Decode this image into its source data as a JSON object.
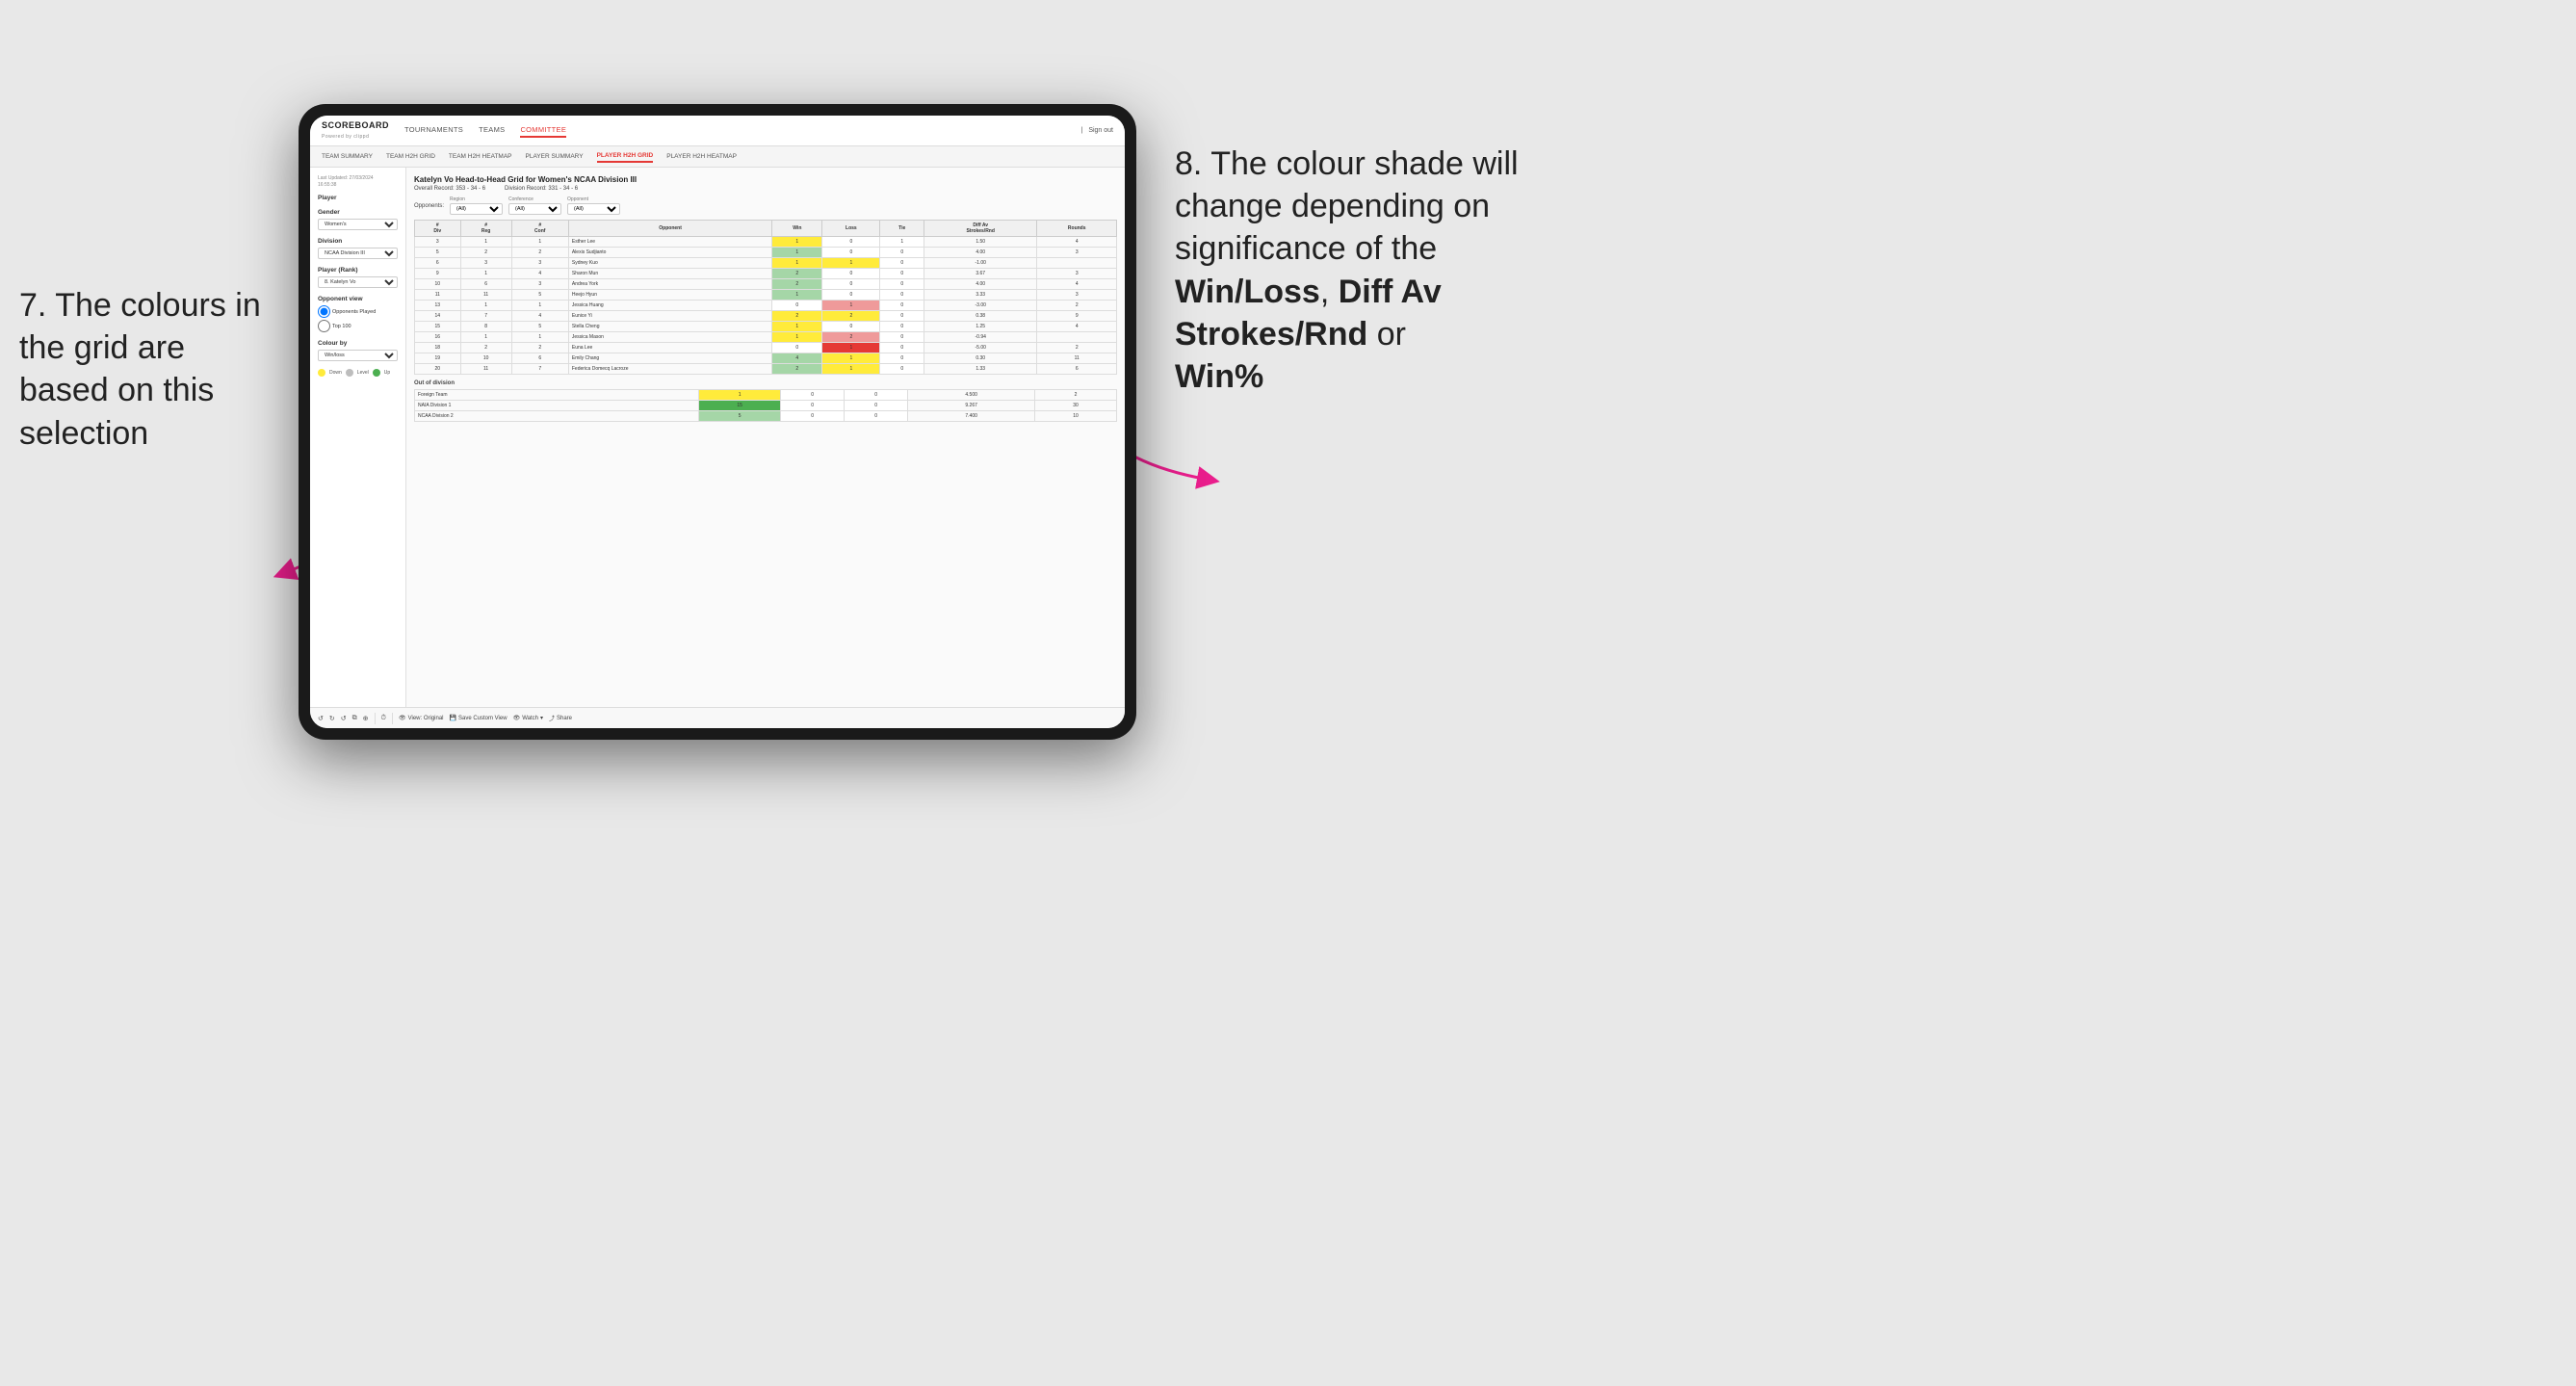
{
  "annotations": {
    "left_title": "7. The colours in the grid are based on this selection",
    "right_title": "8. The colour shade will change depending on significance of the",
    "right_bold1": "Win/Loss",
    "right_bold2": "Diff Av Strokes/Rnd",
    "right_bold3": "Win%",
    "right_connector": "or"
  },
  "nav": {
    "logo": "SCOREBOARD",
    "powered": "Powered by clippd",
    "items": [
      "TOURNAMENTS",
      "TEAMS",
      "COMMITTEE"
    ],
    "active": "COMMITTEE",
    "sign_out": "Sign out"
  },
  "sub_nav": {
    "items": [
      "TEAM SUMMARY",
      "TEAM H2H GRID",
      "TEAM H2H HEATMAP",
      "PLAYER SUMMARY",
      "PLAYER H2H GRID",
      "PLAYER H2H HEATMAP"
    ],
    "active": "PLAYER H2H GRID"
  },
  "sidebar": {
    "last_updated_label": "Last Updated: 27/03/2024",
    "last_updated_time": "16:55:38",
    "player_label": "Player",
    "gender_label": "Gender",
    "gender_value": "Women's",
    "division_label": "Division",
    "division_value": "NCAA Division III",
    "player_rank_label": "Player (Rank)",
    "player_rank_value": "8. Katelyn Vo",
    "opponent_view_label": "Opponent view",
    "radio1": "Opponents Played",
    "radio2": "Top 100",
    "colour_by_label": "Colour by",
    "colour_by_value": "Win/loss",
    "legend": {
      "down_label": "Down",
      "level_label": "Level",
      "up_label": "Up"
    }
  },
  "grid": {
    "title": "Katelyn Vo Head-to-Head Grid for Women's NCAA Division III",
    "overall_record_label": "Overall Record:",
    "overall_record": "353 - 34 - 6",
    "division_record_label": "Division Record:",
    "division_record": "331 - 34 - 6",
    "filter_opponents_label": "Opponents:",
    "filter_region_label": "Region",
    "filter_region_value": "(All)",
    "filter_conference_label": "Conference",
    "filter_conference_value": "(All)",
    "filter_opponent_label": "Opponent",
    "filter_opponent_value": "(All)",
    "headers": [
      "#\nDiv",
      "#\nReg",
      "#\nConf",
      "Opponent",
      "Win",
      "Loss",
      "Tie",
      "Diff Av\nStrokes/Rnd",
      "Rounds"
    ],
    "rows": [
      {
        "div": "3",
        "reg": "1",
        "conf": "1",
        "opponent": "Esther Lee",
        "win": 1,
        "loss": 0,
        "tie": 1,
        "diff": "1.50",
        "rounds": "4",
        "win_color": "yellow",
        "loss_color": "white",
        "tie_color": "white"
      },
      {
        "div": "5",
        "reg": "2",
        "conf": "2",
        "opponent": "Alexis Sudjianto",
        "win": 1,
        "loss": 0,
        "tie": 0,
        "diff": "4.00",
        "rounds": "3",
        "win_color": "green-light",
        "loss_color": "white",
        "tie_color": "white"
      },
      {
        "div": "6",
        "reg": "3",
        "conf": "3",
        "opponent": "Sydney Kuo",
        "win": 1,
        "loss": 1,
        "tie": 0,
        "diff": "-1.00",
        "rounds": "",
        "win_color": "yellow",
        "loss_color": "yellow",
        "tie_color": "white"
      },
      {
        "div": "9",
        "reg": "1",
        "conf": "4",
        "opponent": "Sharon Mun",
        "win": 2,
        "loss": 0,
        "tie": 0,
        "diff": "3.67",
        "rounds": "3",
        "win_color": "green-light",
        "loss_color": "white",
        "tie_color": "white"
      },
      {
        "div": "10",
        "reg": "6",
        "conf": "3",
        "opponent": "Andrea York",
        "win": 2,
        "loss": 0,
        "tie": 0,
        "diff": "4.00",
        "rounds": "4",
        "win_color": "green-light",
        "loss_color": "white",
        "tie_color": "white"
      },
      {
        "div": "11",
        "reg": "11",
        "conf": "5",
        "opponent": "Heejo Hyun",
        "win": 1,
        "loss": 0,
        "tie": 0,
        "diff": "3.33",
        "rounds": "3",
        "win_color": "green-light",
        "loss_color": "white",
        "tie_color": "white"
      },
      {
        "div": "13",
        "reg": "1",
        "conf": "1",
        "opponent": "Jessica Huang",
        "win": 0,
        "loss": 1,
        "tie": 0,
        "diff": "-3.00",
        "rounds": "2",
        "win_color": "white",
        "loss_color": "red",
        "tie_color": "white"
      },
      {
        "div": "14",
        "reg": "7",
        "conf": "4",
        "opponent": "Eunice Yi",
        "win": 2,
        "loss": 2,
        "tie": 0,
        "diff": "0.38",
        "rounds": "9",
        "win_color": "yellow",
        "loss_color": "yellow",
        "tie_color": "white"
      },
      {
        "div": "15",
        "reg": "8",
        "conf": "5",
        "opponent": "Stella Cheng",
        "win": 1,
        "loss": 0,
        "tie": 0,
        "diff": "1.25",
        "rounds": "4",
        "win_color": "yellow",
        "loss_color": "white",
        "tie_color": "white"
      },
      {
        "div": "16",
        "reg": "1",
        "conf": "1",
        "opponent": "Jessica Mason",
        "win": 1,
        "loss": 2,
        "tie": 0,
        "diff": "-0.94",
        "rounds": "",
        "win_color": "yellow",
        "loss_color": "red",
        "tie_color": "white"
      },
      {
        "div": "18",
        "reg": "2",
        "conf": "2",
        "opponent": "Euna Lee",
        "win": 0,
        "loss": 1,
        "tie": 0,
        "diff": "-5.00",
        "rounds": "2",
        "win_color": "white",
        "loss_color": "red-dark",
        "tie_color": "white"
      },
      {
        "div": "19",
        "reg": "10",
        "conf": "6",
        "opponent": "Emily Chang",
        "win": 4,
        "loss": 1,
        "tie": 0,
        "diff": "0.30",
        "rounds": "11",
        "win_color": "green-light",
        "loss_color": "yellow",
        "tie_color": "white"
      },
      {
        "div": "20",
        "reg": "11",
        "conf": "7",
        "opponent": "Federica Domecq Lacroze",
        "win": 2,
        "loss": 1,
        "tie": 0,
        "diff": "1.33",
        "rounds": "6",
        "win_color": "green-light",
        "loss_color": "yellow",
        "tie_color": "white"
      }
    ],
    "out_of_division_label": "Out of division",
    "out_of_division_rows": [
      {
        "opponent": "Foreign Team",
        "win": 1,
        "loss": 0,
        "tie": 0,
        "diff": "4.500",
        "rounds": "2",
        "win_color": "yellow",
        "loss_color": "white",
        "tie_color": "white"
      },
      {
        "opponent": "NAIA Division 1",
        "win": 15,
        "loss": 0,
        "tie": 0,
        "diff": "9.267",
        "rounds": "30",
        "win_color": "green-dark",
        "loss_color": "white",
        "tie_color": "white"
      },
      {
        "opponent": "NCAA Division 2",
        "win": 5,
        "loss": 0,
        "tie": 0,
        "diff": "7.400",
        "rounds": "10",
        "win_color": "green-light",
        "loss_color": "white",
        "tie_color": "white"
      }
    ]
  },
  "toolbar": {
    "view_original": "View: Original",
    "save_custom": "Save Custom View",
    "watch": "Watch",
    "share": "Share"
  }
}
